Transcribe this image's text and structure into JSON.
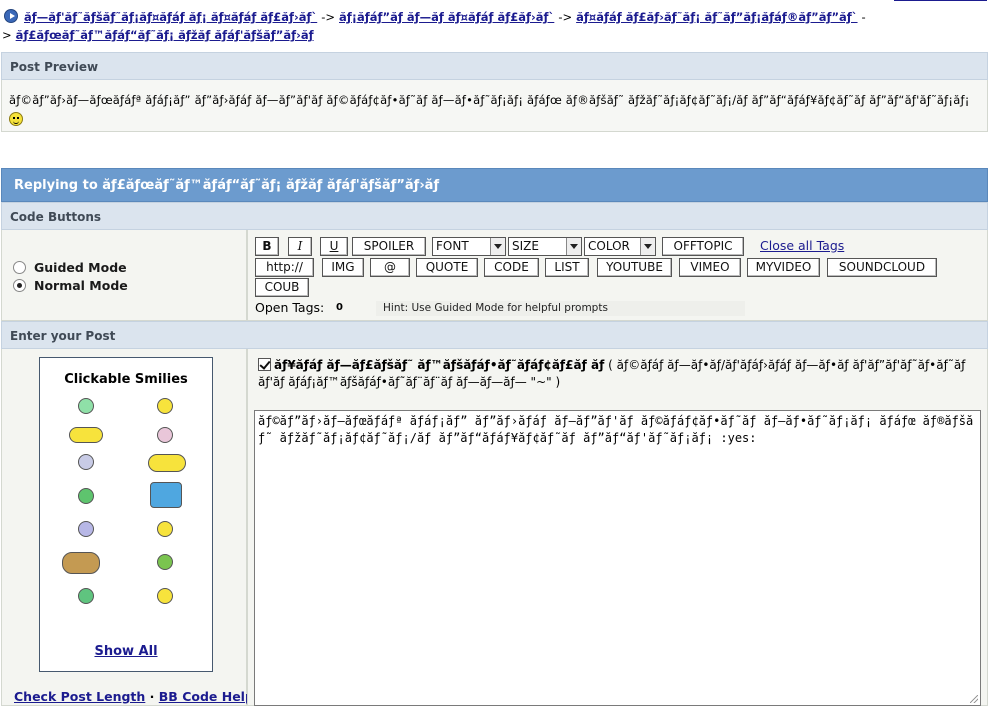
{
  "breadcrumb": {
    "items": [
      "ăƒ—ăƒ'ăƒ˜ăƒšăƒ˜ăƒ¡ăƒ¤ăƒáƒ ăƒ¡ ăƒ¤ăƒáƒ ăƒ£ăƒ›ăƒ`",
      "ăƒ¡ăƒáƒ”ăƒ ăƒ—ăƒ ăƒ¤ăƒáƒ ăƒ£ăƒ›ăƒ`",
      "ăƒ¤ăƒáƒ ăƒ£ăƒ›ăƒ˜ăƒ¡ ăƒ˜ăƒ”ăƒ¡ăƒáƒ®ăƒ”ăƒ”ăƒ`",
      "ăƒ£ăƒœăƒ˜ăƒ™ăƒáƒ“ăƒ˜ăƒ¡ ăƒžăƒ ăƒáƒ'ăƒšăƒ”ăƒ›ăƒ"
    ],
    "separator": "->"
  },
  "preview": {
    "header": "Post Preview",
    "text": "ăƒ©ăƒ”ăƒ›ăƒ—ăƒœăƒáƒª ăƒáƒ¡ăƒ” ăƒ”ăƒ›ăƒáƒ ăƒ—ăƒ”ăƒ'ăƒ ăƒ©ăƒáƒ¢ăƒ•ăƒ˜ăƒ ăƒ—ăƒ•ăƒ˜ăƒ¡ăƒ¡ ăƒáƒœ ăƒ®ăƒšăƒ˜ ăƒžăƒ˜ăƒ¡ăƒ¢ăƒ˜ăƒ¡/ăƒ ăƒ”ăƒ“ăƒáƒ¥ăƒ¢ăƒ˜ăƒ ăƒ”ăƒ“ăƒ'ăƒ˜ăƒ¡ăƒ¡"
  },
  "reply": {
    "title": "Replying to ăƒ£ăƒœăƒ˜ăƒ™ăƒáƒ“ăƒ˜ăƒ¡ ăƒžăƒ ăƒáƒ'ăƒšăƒ”ăƒ›ăƒ"
  },
  "code_buttons": {
    "header": "Code Buttons",
    "modes": [
      "Guided Mode",
      "Normal Mode"
    ],
    "selected_mode": "Normal Mode",
    "row1": [
      "B",
      "I",
      "U",
      "SPOILER"
    ],
    "selects": {
      "font": "FONT",
      "size": "SIZE",
      "color": "COLOR"
    },
    "offtopic": "OFFTOPIC",
    "close_all": "Close all Tags",
    "row2": [
      "http://",
      "IMG",
      "@",
      "QUOTE",
      "CODE",
      "LIST",
      "YOUTUBE",
      "VIMEO",
      "MYVIDEO",
      "SOUNDCLOUD"
    ],
    "row3": [
      "COUB"
    ],
    "open_tags_label": "Open Tags:",
    "open_tags_count": "0",
    "hint": "Hint: Use Guided Mode for helpful prompts"
  },
  "enter_post": {
    "header": "Enter your Post",
    "smilies_title": "Clickable Smilies",
    "smilies_icons": [
      "alien-icon",
      "smile-icon",
      "twins-icon",
      "eye-roll-icon",
      "ghost-icon",
      "juggle-icon",
      "frog-icon",
      "drowning-icon",
      "cool-icon",
      "peace-icon",
      "viking-icon",
      "army-icon",
      "blink-icon",
      "hide-icon"
    ],
    "show_all": "Show All",
    "check_length": "Check Post Length",
    "link_separator": "·",
    "bb_help": "BB Code Help",
    "checkbox_label": "ăƒ¥ăƒáƒ ăƒ—ăƒ£ăƒšăƒ˜ ăƒ™ăƒšăƒáƒ•ăƒ˜ăƒáƒ¢ăƒ£ăƒ ăƒ",
    "checkbox_hint": "( ăƒ©ăƒáƒ ăƒ—ăƒ•ăƒ/ăƒ'ăƒáƒ›ăƒáƒ ăƒ—ăƒ•ăƒ ăƒ'ăƒ”ăƒ'ăƒ˜ăƒ•ăƒ˜ăƒ ăƒ'ăƒ ăƒáƒ¡ăƒ™ăƒšăƒáƒ•ăƒ˜ăƒ¨ăƒ¨ăƒ ăƒ—ăƒ—ăƒ— \"~\" )",
    "checked": true,
    "textarea_value": "ăƒ©ăƒ”ăƒ›ăƒ—ăƒœăƒáƒª ăƒáƒ¡ăƒ” ăƒ”ăƒ›ăƒáƒ ăƒ—ăƒ”ăƒ'ăƒ ăƒ©ăƒáƒ¢ăƒ•ăƒ˜ăƒ ăƒ—ăƒ•ăƒ˜ăƒ¡ăƒ¡ ăƒáƒœ ăƒ®ăƒšăƒ˜ ăƒžăƒ˜ăƒ¡ăƒ¢ăƒ˜ăƒ¡/ăƒ ăƒ”ăƒ“ăƒáƒ¥ăƒ¢ăƒ˜ăƒ ăƒ”ăƒ“ăƒ'ăƒ˜ăƒ¡ăƒ¡ :yes:"
  },
  "colors": {
    "link": "#1b1b8f",
    "section_header_bg": "#dbe4ee",
    "reply_title_bg": "#6c9bce",
    "panel_bg": "#f4f5f1"
  }
}
